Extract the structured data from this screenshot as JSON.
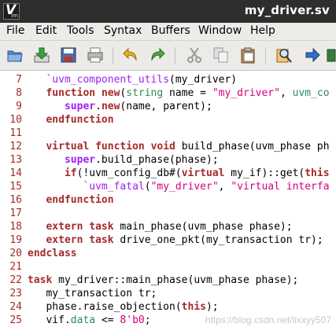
{
  "window": {
    "title": "my_driver.sv",
    "icon_letter": "V",
    "icon_sub": "im"
  },
  "menu": [
    "File",
    "Edit",
    "Tools",
    "Syntax",
    "Buffers",
    "Window",
    "Help"
  ],
  "toolbar_icons": [
    "open-folder-icon",
    "save-download-icon",
    "save-disk-icon",
    "print-icon",
    "undo-icon",
    "redo-icon",
    "cut-icon",
    "copy-icon",
    "paste-icon",
    "find-replace-icon",
    "forward-arrow-icon"
  ],
  "lines": [
    {
      "num": "7",
      "tokens": [
        [
          "n",
          "   "
        ],
        [
          "pd",
          "`uvm_component_utils"
        ],
        [
          "n",
          "(my_driver)"
        ]
      ]
    },
    {
      "num": "8",
      "tokens": [
        [
          "n",
          "   "
        ],
        [
          "k",
          "function"
        ],
        [
          "n",
          " "
        ],
        [
          "k",
          "new"
        ],
        [
          "n",
          "("
        ],
        [
          "g",
          "string"
        ],
        [
          "n",
          " name = "
        ],
        [
          "s",
          "\"my_driver\""
        ],
        [
          "n",
          ", "
        ],
        [
          "g",
          "uvm_co"
        ]
      ]
    },
    {
      "num": "9",
      "tokens": [
        [
          "n",
          "      "
        ],
        [
          "kp",
          "super"
        ],
        [
          "n",
          "."
        ],
        [
          "k",
          "new"
        ],
        [
          "n",
          "(name, parent);"
        ]
      ]
    },
    {
      "num": "10",
      "tokens": [
        [
          "n",
          "   "
        ],
        [
          "k",
          "endfunction"
        ]
      ]
    },
    {
      "num": "11",
      "tokens": []
    },
    {
      "num": "12",
      "tokens": [
        [
          "n",
          "   "
        ],
        [
          "k",
          "virtual"
        ],
        [
          "n",
          " "
        ],
        [
          "k",
          "function"
        ],
        [
          "n",
          " "
        ],
        [
          "k",
          "void"
        ],
        [
          "n",
          " build_phase(uvm_phase ph"
        ]
      ]
    },
    {
      "num": "13",
      "tokens": [
        [
          "n",
          "      "
        ],
        [
          "kp",
          "super"
        ],
        [
          "n",
          ".build_phase(phase);"
        ]
      ]
    },
    {
      "num": "14",
      "tokens": [
        [
          "n",
          "      "
        ],
        [
          "k",
          "if"
        ],
        [
          "n",
          "(!uvm_config_db#("
        ],
        [
          "k",
          "virtual"
        ],
        [
          "n",
          " my_if)::get("
        ],
        [
          "k",
          "this"
        ]
      ]
    },
    {
      "num": "15",
      "tokens": [
        [
          "n",
          "         "
        ],
        [
          "pd",
          "`uvm_fatal"
        ],
        [
          "n",
          "("
        ],
        [
          "s",
          "\"my_driver\""
        ],
        [
          "n",
          ", "
        ],
        [
          "s",
          "\"virtual interfa"
        ]
      ]
    },
    {
      "num": "16",
      "tokens": [
        [
          "n",
          "   "
        ],
        [
          "k",
          "endfunction"
        ]
      ]
    },
    {
      "num": "17",
      "tokens": []
    },
    {
      "num": "18",
      "tokens": [
        [
          "n",
          "   "
        ],
        [
          "k",
          "extern"
        ],
        [
          "n",
          " "
        ],
        [
          "k",
          "task"
        ],
        [
          "n",
          " main_phase(uvm_phase phase);"
        ]
      ]
    },
    {
      "num": "19",
      "tokens": [
        [
          "n",
          "   "
        ],
        [
          "k",
          "extern"
        ],
        [
          "n",
          " "
        ],
        [
          "k",
          "task"
        ],
        [
          "n",
          " drive_one_pkt(my_transaction tr);"
        ]
      ]
    },
    {
      "num": "20",
      "tokens": [
        [
          "k",
          "endclass"
        ]
      ]
    },
    {
      "num": "21",
      "tokens": []
    },
    {
      "num": "22",
      "tokens": [
        [
          "k",
          "task"
        ],
        [
          "n",
          " my_driver::main_phase(uvm_phase phase);"
        ]
      ]
    },
    {
      "num": "23",
      "tokens": [
        [
          "n",
          "   my_transaction tr;"
        ]
      ]
    },
    {
      "num": "24",
      "tokens": [
        [
          "n",
          "   phase.raise_objection("
        ],
        [
          "k",
          "this"
        ],
        [
          "n",
          ");"
        ]
      ]
    },
    {
      "num": "25",
      "tokens": [
        [
          "n",
          "   vif."
        ],
        [
          "g",
          "data"
        ],
        [
          "n",
          " <= "
        ],
        [
          "m2",
          "8'b0"
        ],
        [
          "n",
          ";"
        ]
      ]
    }
  ],
  "watermark": "https://blog.csdn.net/lixxyy507"
}
